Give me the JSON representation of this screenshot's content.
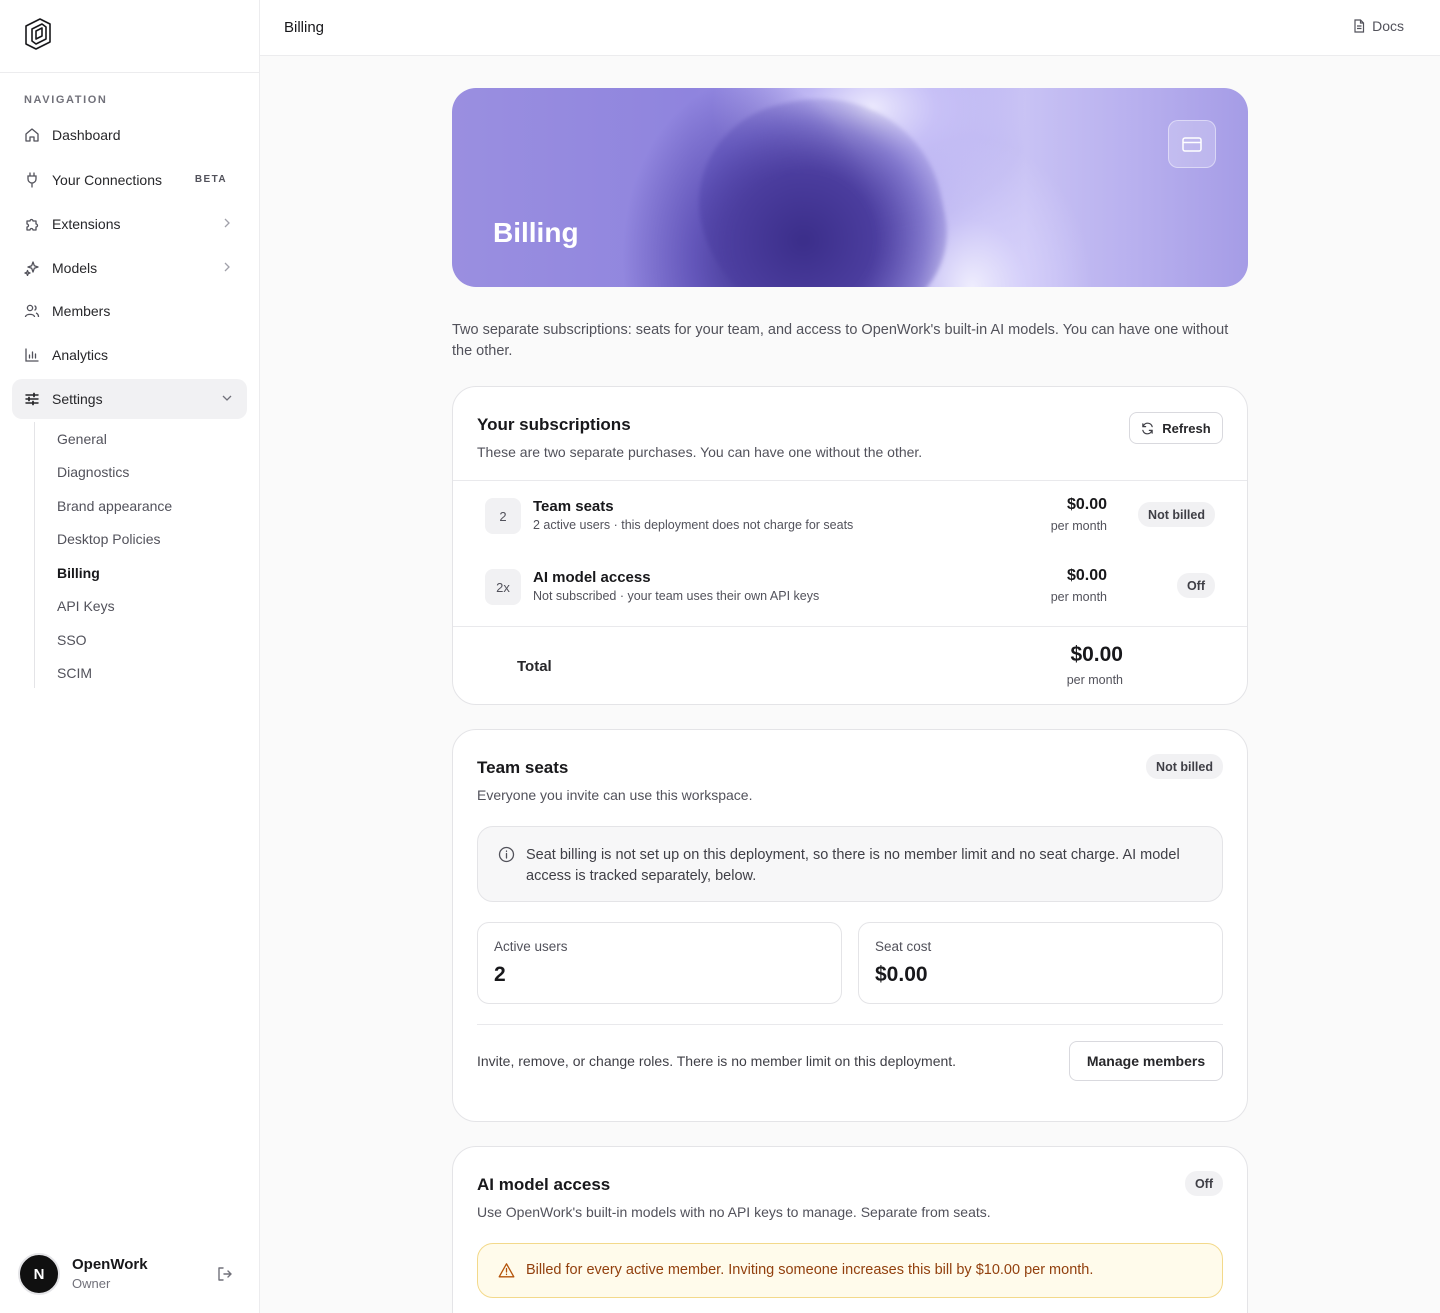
{
  "sidebar": {
    "logo_icon": "openwork-logo-icon",
    "nav_label": "NAVIGATION",
    "items": [
      {
        "label": "Dashboard",
        "icon": "home-icon"
      },
      {
        "label": "Your Connections",
        "icon": "plug-icon",
        "badge": "BETA"
      },
      {
        "label": "Extensions",
        "icon": "puzzle-icon"
      },
      {
        "label": "Models",
        "icon": "sparkles-icon"
      },
      {
        "label": "Members",
        "icon": "users-icon"
      },
      {
        "label": "Analytics",
        "icon": "bar-chart-icon"
      },
      {
        "label": "Settings",
        "icon": "sliders-icon"
      }
    ],
    "settings_items": [
      "General",
      "Diagnostics",
      "Brand appearance",
      "Desktop Policies",
      "Billing",
      "API Keys",
      "SSO",
      "SCIM"
    ],
    "active_settings_item": "Billing",
    "user": {
      "initial": "N",
      "name": "OpenWork",
      "role": "Owner"
    }
  },
  "topbar": {
    "breadcrumb": "Billing",
    "docs_label": "Docs"
  },
  "hero": {
    "title": "Billing",
    "icon": "credit-card-icon"
  },
  "intro": "Two separate subscriptions: seats for your team, and access to OpenWork's built-in AI models. You can have one without the other.",
  "subscriptions": {
    "title": "Your subscriptions",
    "subtitle": "These are two separate purchases. You can have one without the other.",
    "refresh_label": "Refresh",
    "rows": [
      {
        "badge": "2",
        "name": "Team seats",
        "desc": "2 active users · this deployment does not charge for seats",
        "price": "$0.00",
        "period": "per month",
        "status": "Not billed"
      },
      {
        "badge": "2x",
        "name": "AI model access",
        "desc": "Not subscribed · your team uses their own API keys",
        "price": "$0.00",
        "period": "per month",
        "status": "Off"
      }
    ],
    "total_label": "Total",
    "total_price": "$0.00",
    "total_period": "per month"
  },
  "team_seats": {
    "title": "Team seats",
    "status": "Not billed",
    "subtitle": "Everyone you invite can use this workspace.",
    "info": "Seat billing is not set up on this deployment, so there is no member limit and no seat charge. AI model access is tracked separately, below.",
    "stats": [
      {
        "label": "Active users",
        "value": "2"
      },
      {
        "label": "Seat cost",
        "value": "$0.00"
      }
    ],
    "footnote": "Invite, remove, or change roles. There is no member limit on this deployment.",
    "manage_label": "Manage members"
  },
  "ai_access": {
    "title": "AI model access",
    "status": "Off",
    "subtitle": "Use OpenWork's built-in models with no API keys to manage. Separate from seats.",
    "warning": "Billed for every active member. Inviting someone increases this bill by $10.00 per month."
  },
  "colors": {
    "accent": "#8f84de",
    "warning_bg": "#fffbeb",
    "warning_text": "#92400e"
  }
}
